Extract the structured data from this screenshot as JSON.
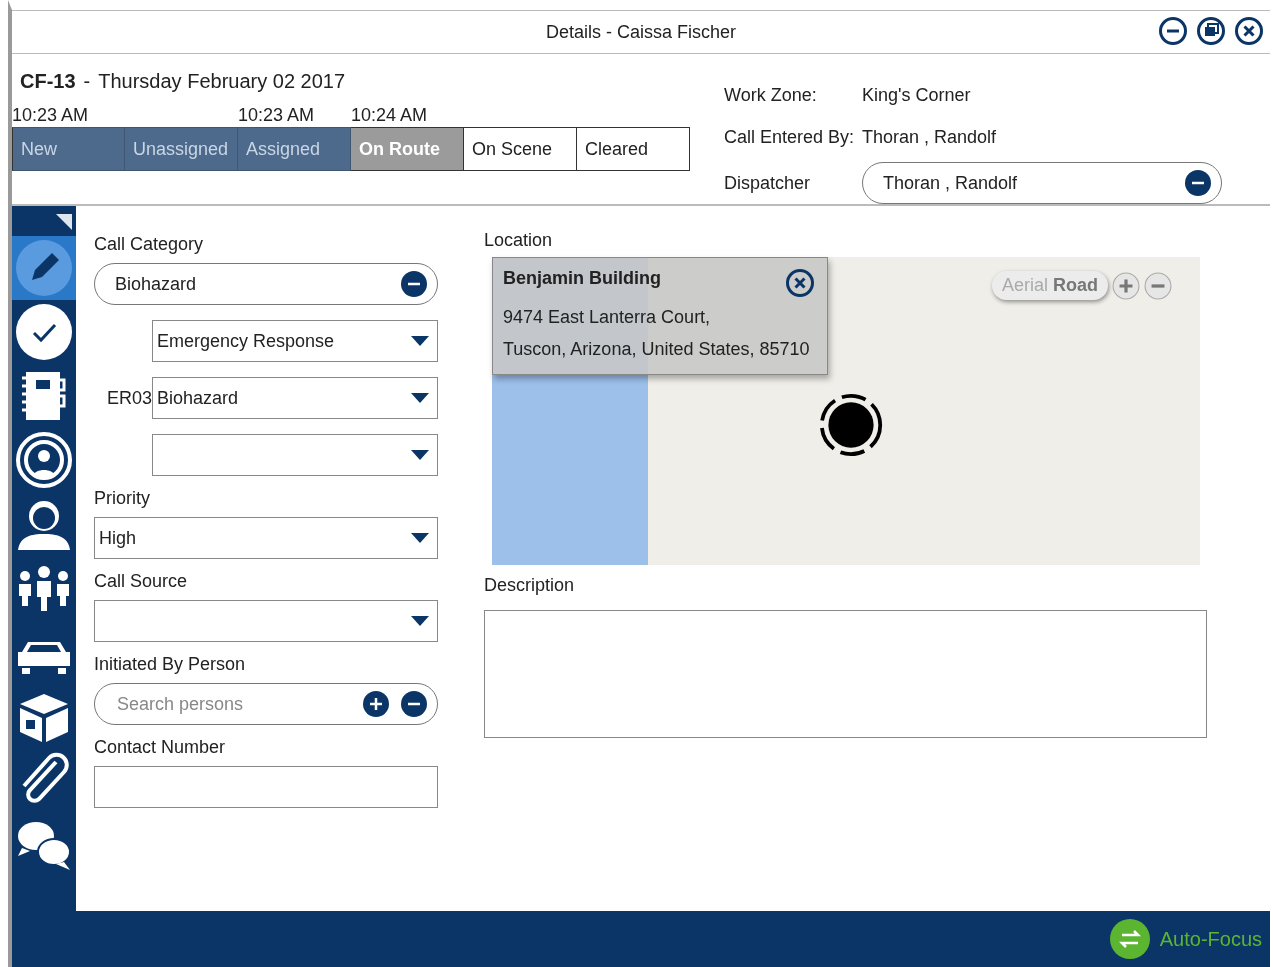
{
  "window": {
    "title": "Details - Caissa Fischer"
  },
  "call": {
    "id": "CF-13",
    "separator": "-",
    "date": "Thursday February 02 2017"
  },
  "stages": [
    {
      "label": "New",
      "time": "10:23 AM",
      "completed": true,
      "selected": false
    },
    {
      "label": "Unassigned",
      "completed": true,
      "selected": false
    },
    {
      "label": "Assigned",
      "time": "10:23 AM",
      "completed": true,
      "selected": false
    },
    {
      "label": "On Route",
      "time": "10:24 AM",
      "completed": false,
      "selected": true
    },
    {
      "label": "On Scene",
      "completed": false,
      "selected": false
    },
    {
      "label": "Cleared",
      "completed": false,
      "selected": false
    }
  ],
  "info": {
    "work_zone_label": "Work Zone:",
    "work_zone": "King's Corner",
    "entered_by_label": "Call Entered By:",
    "entered_by": "Thoran , Randolf",
    "dispatcher_label": "Dispatcher",
    "dispatcher": "Thoran , Randolf"
  },
  "sidebar": {
    "items": [
      {
        "kind": "pencil",
        "selected": true
      },
      {
        "kind": "check",
        "selected": false
      },
      {
        "kind": "notebook",
        "selected": false
      },
      {
        "kind": "broadcast",
        "selected": false
      },
      {
        "kind": "person",
        "selected": false
      },
      {
        "kind": "group",
        "selected": false
      },
      {
        "kind": "car",
        "selected": false
      },
      {
        "kind": "box",
        "selected": false
      },
      {
        "kind": "paperclip",
        "selected": false
      },
      {
        "kind": "chat",
        "selected": false
      }
    ]
  },
  "form": {
    "call_category_label": "Call Category",
    "call_category": "Biohazard",
    "category_dropdowns": [
      {
        "value": "Emergency Response"
      },
      {
        "code": "ER03",
        "value": "Biohazard"
      }
    ],
    "priority_label": "Priority",
    "priority": "High",
    "call_source_label": "Call Source",
    "initiated_by_label": "Initiated By Person",
    "search_placeholder": "Search persons",
    "contact_number_label": "Contact Number"
  },
  "location": {
    "label": "Location",
    "popup": {
      "title": "Benjamin Building",
      "lines": [
        "9474 East Lanterra Court,",
        "Tuscon, Arizona, United States, 85710"
      ]
    },
    "map_types": [
      {
        "label": "Aerial",
        "selected": false
      },
      {
        "label": "Road",
        "selected": true
      }
    ]
  },
  "description": {
    "label": "Description"
  },
  "footer": {
    "auto_focus": "Auto-Focus"
  }
}
